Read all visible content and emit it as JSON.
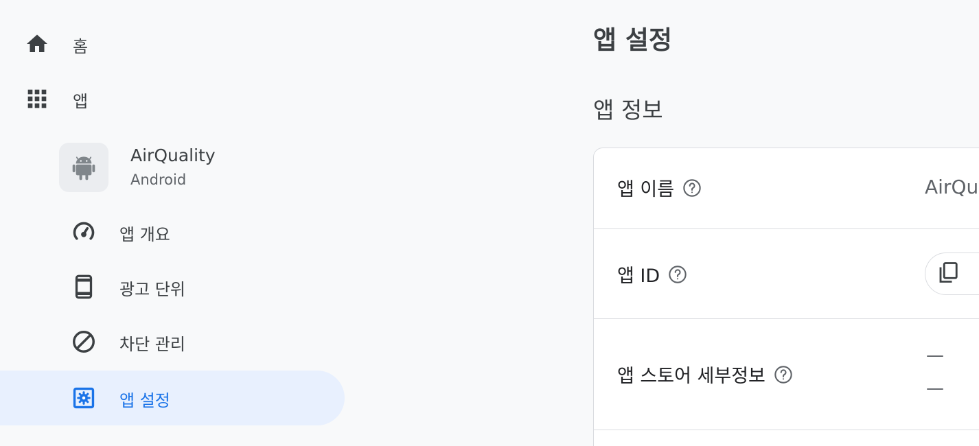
{
  "sidebar": {
    "home_label": "홈",
    "apps_label": "앱",
    "app": {
      "name": "AirQuality",
      "platform": "Android"
    },
    "items": [
      {
        "label": "앱 개요",
        "icon": "speedometer-icon"
      },
      {
        "label": "광고 단위",
        "icon": "ad-unit-icon"
      },
      {
        "label": "차단 관리",
        "icon": "block-icon"
      },
      {
        "label": "앱 설정",
        "icon": "settings-app-icon"
      }
    ]
  },
  "main": {
    "page_title": "앱 설정",
    "section_title": "앱 정보",
    "rows": [
      {
        "label": "앱 이름",
        "value": "AirQu"
      },
      {
        "label": "앱 ID"
      },
      {
        "label": "앱 스토어 세부정보",
        "values": [
          "—",
          "—"
        ]
      }
    ]
  },
  "colors": {
    "accent": "#1a73e8",
    "active_bg": "#e8f0fe",
    "page_bg": "#f8f9fa"
  }
}
